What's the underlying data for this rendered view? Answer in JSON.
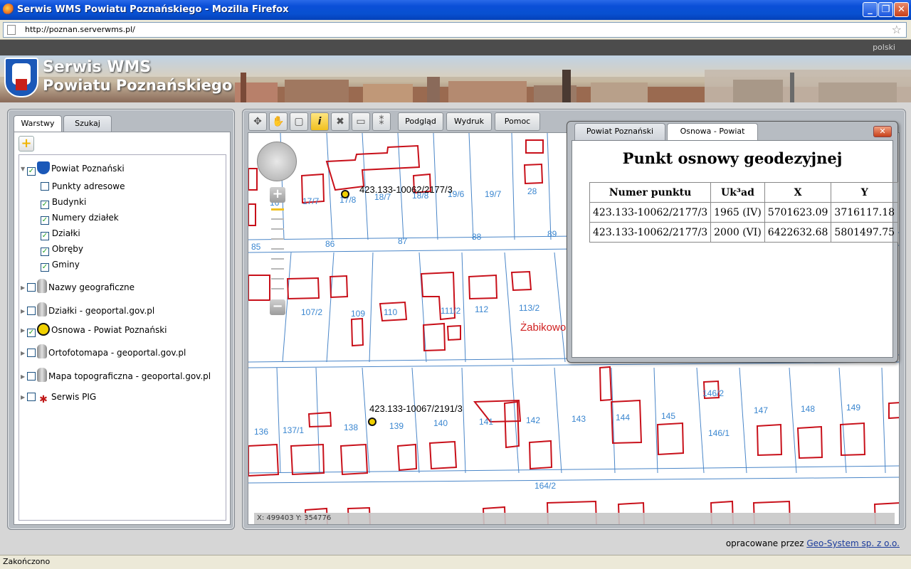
{
  "window": {
    "title": "Serwis WMS Powiatu Poznańskiego - Mozilla Firefox"
  },
  "browser": {
    "url": "http://poznan.serverwms.pl/",
    "status": "Zakończono"
  },
  "header": {
    "lang": "polski",
    "title_line1": "Serwis WMS",
    "title_line2": "Powiatu Poznańskiego"
  },
  "left_panel": {
    "tabs": [
      {
        "label": "Warstwy"
      },
      {
        "label": "Szukaj"
      }
    ],
    "layers": [
      {
        "label": "Powiat Poznański",
        "checked": true,
        "icon": "coat-of-arms-icon"
      },
      {
        "label": "Punkty adresowe",
        "checked": false
      },
      {
        "label": "Budynki",
        "checked": true
      },
      {
        "label": "Numery działek",
        "checked": true
      },
      {
        "label": "Działki",
        "checked": true
      },
      {
        "label": "Obręby",
        "checked": true
      },
      {
        "label": "Gminy",
        "checked": true
      },
      {
        "label": "Nazwy geograficzne",
        "checked": false,
        "icon": "globe-icon"
      },
      {
        "label": "Działki - geoportal.gov.pl",
        "checked": false,
        "icon": "globe-icon"
      },
      {
        "label": "Osnowa - Powiat Poznański",
        "checked": true,
        "icon": "survey-point-icon"
      },
      {
        "label": "Ortofotomapa - geoportal.gov.pl",
        "checked": false,
        "icon": "globe-icon"
      },
      {
        "label": "Mapa topograficzna - geoportal.gov.pl",
        "checked": false,
        "icon": "globe-icon"
      },
      {
        "label": "Serwis PIG",
        "checked": false,
        "icon": "pig-icon"
      }
    ]
  },
  "toolbar": {
    "preview": "Podgląd",
    "print": "Wydruk",
    "help": "Pomoc"
  },
  "map": {
    "coords": "X: 499403 Y: 354776",
    "point_labels": [
      "423.133-10062/2177/3",
      "423.133-10067/2191/3"
    ],
    "place_name": "Żabikowo",
    "parcels": [
      "16",
      "17/7",
      "17/8",
      "18/7",
      "18/8",
      "19/6",
      "19/7",
      "28",
      "85",
      "86",
      "87",
      "88",
      "89",
      "107/2",
      "109",
      "110",
      "111/2",
      "112",
      "113/2",
      "136",
      "137/1",
      "138",
      "139",
      "140",
      "141",
      "142",
      "143",
      "144",
      "145",
      "146/2",
      "146/1",
      "147",
      "148",
      "149",
      "164/2"
    ]
  },
  "popup": {
    "tabs": [
      "Powiat Poznański",
      "Osnowa - Powiat Pozn..."
    ],
    "close": "x",
    "title": "Punkt osnowy geodezyjnej",
    "columns": [
      "Numer punktu",
      "Uk³ad",
      "X",
      "Y"
    ],
    "rows": [
      [
        "423.133-10062/2177/3",
        "1965 (IV)",
        "5701623.09",
        "3716117.18"
      ],
      [
        "423.133-10062/2177/3",
        "2000 (VI)",
        "6422632.68",
        "5801497.75"
      ]
    ]
  },
  "footer": {
    "prefix": "opracowane przez",
    "link": "Geo-System sp. z o.o."
  }
}
